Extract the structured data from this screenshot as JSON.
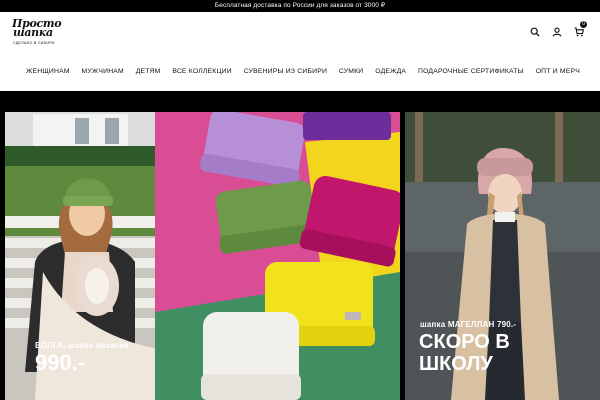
{
  "topbar": {
    "text": "Бесплатная доставка по России для заказов от 3000 ₽"
  },
  "logo": {
    "line1": "Просто",
    "line2": "шапка",
    "tagline": "СДЕЛАНО В СИБИРИ"
  },
  "header": {
    "icons": [
      "search-icon",
      "user-icon",
      "cart-icon"
    ],
    "cart_count": "0"
  },
  "nav": {
    "items": [
      "ЖЕНЩИНАМ",
      "МУЖЧИНАМ",
      "ДЕТЯМ",
      "ВСЕ КОЛЛЕКЦИИ",
      "СУВЕНИРЫ ИЗ СИБИРИ",
      "СУМКИ",
      "ОДЕЖДА",
      "ПОДАРОЧНЫЕ СЕРТИФИКАТЫ",
      "ОПТ И МЕРЧ"
    ]
  },
  "banner_left": {
    "caption": "ВОЛГА, шапка вязаная",
    "price": "990.-"
  },
  "banner_right": {
    "caption": "шапка МАГЕЛЛАН 790.-",
    "headline_1": "СКОРО В",
    "headline_2": "ШКОЛУ"
  },
  "colors": {
    "bar": "#000000",
    "hat_lilac": "#b78fd6",
    "hat_purple": "#6d2d9a",
    "hat_olive": "#6f9a4a",
    "hat_magenta": "#c0166b",
    "hat_yellow": "#f1e21c",
    "hat_white": "#f1f0ea",
    "hat_pink": "#d9a7a8",
    "bg_pink": "#d84d93",
    "bg_yellow": "#f2d51c",
    "bg_green": "#3f8f63"
  }
}
